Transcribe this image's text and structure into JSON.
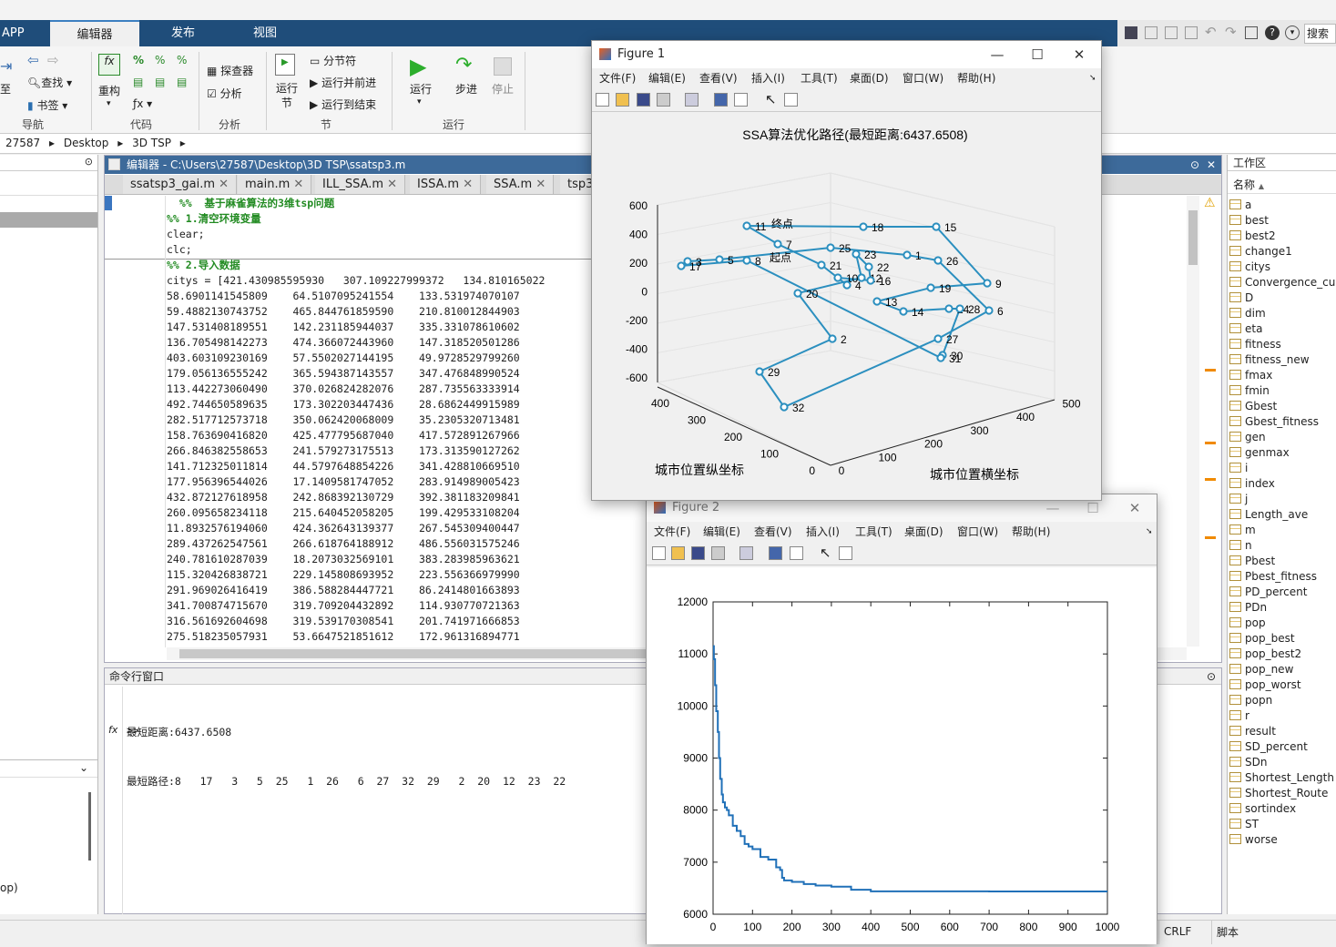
{
  "ribbon": {
    "tabs": [
      "APP",
      "编辑器",
      "发布",
      "视图"
    ],
    "buttons": {
      "goto": "至",
      "find": "查找",
      "bookmark": "书签",
      "refactor": "重构",
      "profiler": "探查器",
      "analyze": "分析",
      "run_section": "运行节",
      "section_break": "分节符",
      "run_advance": "运行并前进",
      "run_to_end": "运行到结束",
      "run": "运行",
      "step": "步进",
      "stop": "停止"
    },
    "groups": {
      "nav": "导航",
      "code": "代码",
      "analyze": "分析",
      "section": "节",
      "run": "运行"
    }
  },
  "quick_access": {
    "search_placeholder": "搜索"
  },
  "address": {
    "crumbs": [
      "27587",
      "Desktop",
      "3D TSP"
    ]
  },
  "editor": {
    "title": "编辑器 - C:\\Users\\27587\\Desktop\\3D TSP\\ssatsp3.m",
    "tabs": [
      "ssatsp3_gai.m",
      "main.m",
      "ILL_SSA.m",
      "ISSA.m",
      "SSA.m",
      "tsp3"
    ],
    "code_lines": [
      "  %%  基于麻雀算法的3维tsp问题",
      "%% 1.清空环境变量",
      "clear;",
      "clc;",
      "%% 2.导入数据",
      "citys = [421.430985595930   307.109227999372   134.810165022",
      "58.6901141545809    64.5107095241554    133.531974070107",
      "59.4882130743752    465.844761859590    210.810012844903",
      "147.531408189551    142.231185944037    335.331078610602",
      "136.705498142273    474.366072443960    147.318520501286",
      "403.603109230169    57.5502027144195    49.9728529799260",
      "179.056136555242    365.594387143557    347.476848990524",
      "113.442273060490    370.026824282076    287.735563333914",
      "492.744650589635    173.302203447436    28.6862449915989",
      "282.517712573718    350.062420068009    35.2305320713481",
      "158.763690416820    425.477795687040    417.572891267966",
      "266.846382558653    241.579273175513    173.313590127262",
      "141.712325011814    44.5797648854226    341.428810669510",
      "177.956396544026    17.1409581747052    283.914989005423",
      "432.872127618958    242.868392130729    392.381183209841",
      "260.095658234118    215.640452058205    199.429533108204",
      "11.8932576194060    424.362643139377    267.545309400447",
      "289.437262547561    266.618764188912    486.556031575246",
      "240.781610287039    18.2073032569101    383.283985963621",
      "115.320426838721    229.145808693952    223.556366979990",
      "291.969026416419    386.588284447721    86.2414801663893",
      "341.700874715670    319.709204432892    114.930770721363",
      "316.561692604698    319.539170308541    201.741971666853",
      "275.518235057931    53.6647521851612    172.961316894771"
    ]
  },
  "command_window": {
    "title": "命令行窗口",
    "lines": [
      "最短距离:6437.6508",
      "最短路径:8   17   3   5  25   1  26   6  27  32  29   2  20  12  23  22"
    ],
    "prompt": ">>"
  },
  "workspace": {
    "title": "工作区",
    "header": "名称",
    "vars": [
      "a",
      "best",
      "best2",
      "change1",
      "citys",
      "Convergence_cu...",
      "D",
      "dim",
      "eta",
      "fitness",
      "fitness_new",
      "fmax",
      "fmin",
      "Gbest",
      "Gbest_fitness",
      "gen",
      "genmax",
      "i",
      "index",
      "j",
      "Length_ave",
      "m",
      "n",
      "Pbest",
      "Pbest_fitness",
      "PD_percent",
      "PDn",
      "pop",
      "pop_best",
      "pop_best2",
      "pop_new",
      "pop_worst",
      "popn",
      "r",
      "result",
      "SD_percent",
      "SDn",
      "Shortest_Length",
      "Shortest_Route",
      "sortindex",
      "ST",
      "worse"
    ]
  },
  "left_panel": {
    "bottom_text": "op)"
  },
  "status_bar": {
    "eol": "CRLF",
    "type": "脚本"
  },
  "figure1": {
    "title": "Figure 1",
    "menu": [
      "文件(F)",
      "编辑(E)",
      "查看(V)",
      "插入(I)",
      "工具(T)",
      "桌面(D)",
      "窗口(W)",
      "帮助(H)"
    ]
  },
  "figure2": {
    "title": "Figure 2",
    "menu": [
      "文件(F)",
      "编辑(E)",
      "查看(V)",
      "插入(I)",
      "工具(T)",
      "桌面(D)",
      "窗口(W)",
      "帮助(H)"
    ]
  },
  "chart_data": [
    {
      "type": "line",
      "title": "SSA算法优化路径(最短距离:6437.6508)",
      "xlabel": "城市位置横坐标",
      "ylabel": "城市位置纵坐标",
      "zticks": [
        "600",
        "400",
        "200",
        "0",
        "-200",
        "-400",
        "-600"
      ],
      "xticks": [
        "0",
        "100",
        "200",
        "300",
        "400",
        "500"
      ],
      "yticks": [
        "0",
        "100",
        "200",
        "300",
        "400"
      ],
      "annotations": [
        "起点",
        "终点"
      ],
      "color": "#2b8fbf",
      "route": [
        8,
        17,
        3,
        5,
        25,
        1,
        26,
        6,
        27,
        32,
        29,
        2,
        20,
        12,
        23,
        22,
        16,
        10,
        4,
        21,
        7,
        11,
        18,
        15,
        9,
        19,
        13,
        14,
        24,
        28,
        30,
        31
      ]
    },
    {
      "type": "line",
      "title": "",
      "xlabel": "",
      "ylabel": "",
      "xlim": [
        0,
        1000
      ],
      "ylim": [
        6000,
        12000
      ],
      "xticks": [
        0,
        100,
        200,
        300,
        400,
        500,
        600,
        700,
        800,
        900,
        1000
      ],
      "yticks": [
        6000,
        7000,
        8000,
        9000,
        10000,
        11000,
        12000
      ],
      "color": "#2070b8",
      "x": [
        0,
        2,
        5,
        8,
        12,
        15,
        18,
        22,
        25,
        30,
        35,
        40,
        50,
        60,
        70,
        80,
        90,
        100,
        120,
        140,
        160,
        170,
        175,
        180,
        200,
        230,
        260,
        300,
        350,
        400,
        500,
        600,
        700,
        800,
        900,
        1000
      ],
      "y": [
        11150,
        10900,
        10400,
        9900,
        9500,
        9000,
        8600,
        8300,
        8150,
        8050,
        8000,
        7900,
        7700,
        7600,
        7500,
        7350,
        7300,
        7250,
        7100,
        7050,
        6900,
        6850,
        6700,
        6650,
        6620,
        6580,
        6550,
        6530,
        6470,
        6440,
        6440,
        6440,
        6438,
        6438,
        6438,
        6438
      ]
    }
  ]
}
